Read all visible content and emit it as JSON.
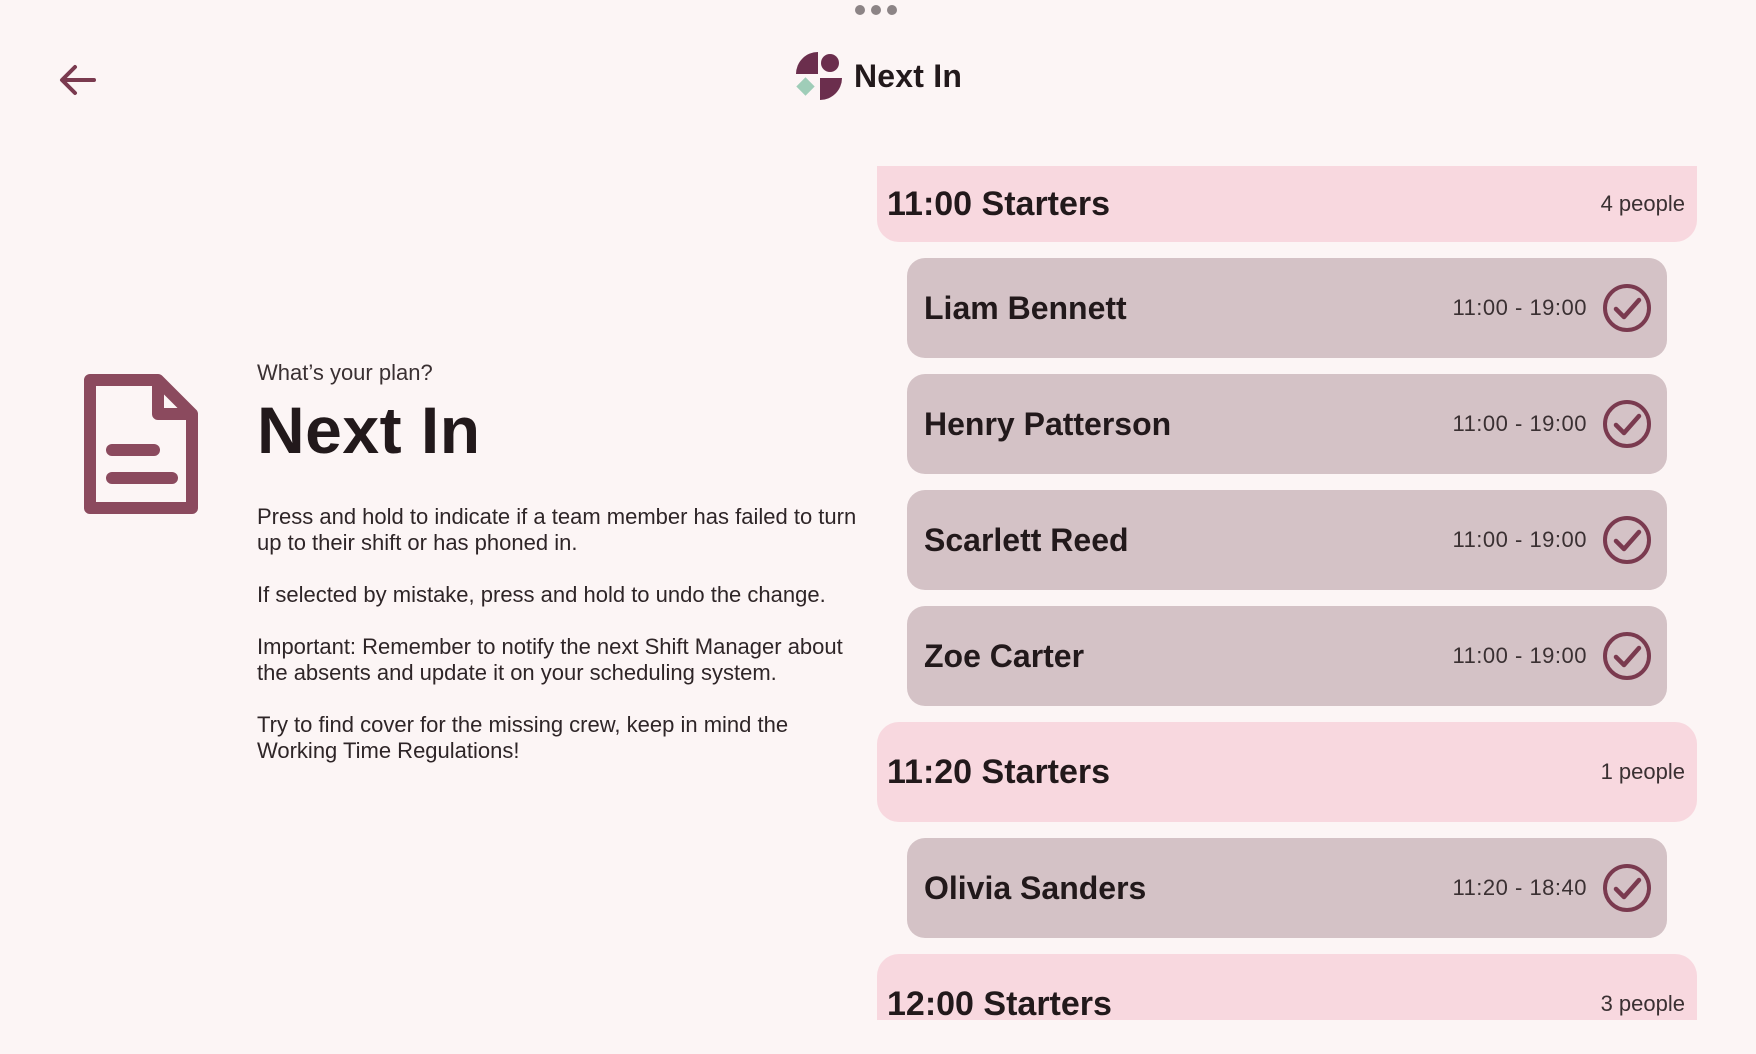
{
  "app": {
    "title": "Next In",
    "colors": {
      "background": "#fcf5f5",
      "accent": "#7a3a4f",
      "group_header_bg": "#f8d8df",
      "member_card_bg": "#d4c2c6",
      "logo_mint": "#9fcdb8"
    }
  },
  "toolbar": {
    "back_icon": "arrow-left-icon",
    "logo_icon": "app-logo-icon"
  },
  "intro": {
    "icon": "document-icon",
    "subtitle": "What’s your plan?",
    "title": "Next In",
    "paragraphs": [
      "Press and hold to indicate if a team member has failed to turn up to their shift or has phoned in.",
      "If selected by mistake, press and hold to undo the change.",
      "Important: Remember to notify the next Shift Manager about the absents and update it on your scheduling system.",
      "Try to find cover for the missing crew, keep in mind the Working Time Regulations!"
    ]
  },
  "groups": [
    {
      "title": "11:00 Starters",
      "count": "4 people",
      "members": [
        {
          "name": "Liam Bennett",
          "time": "11:00 - 19:00"
        },
        {
          "name": "Henry Patterson",
          "time": "11:00 - 19:00"
        },
        {
          "name": "Scarlett Reed",
          "time": "11:00 - 19:00"
        },
        {
          "name": "Zoe Carter",
          "time": "11:00 - 19:00"
        }
      ]
    },
    {
      "title": "11:20 Starters",
      "count": "1 people",
      "members": [
        {
          "name": "Olivia Sanders",
          "time": "11:20 - 18:40"
        }
      ]
    },
    {
      "title": "12:00 Starters",
      "count": "3 people",
      "members": []
    }
  ]
}
